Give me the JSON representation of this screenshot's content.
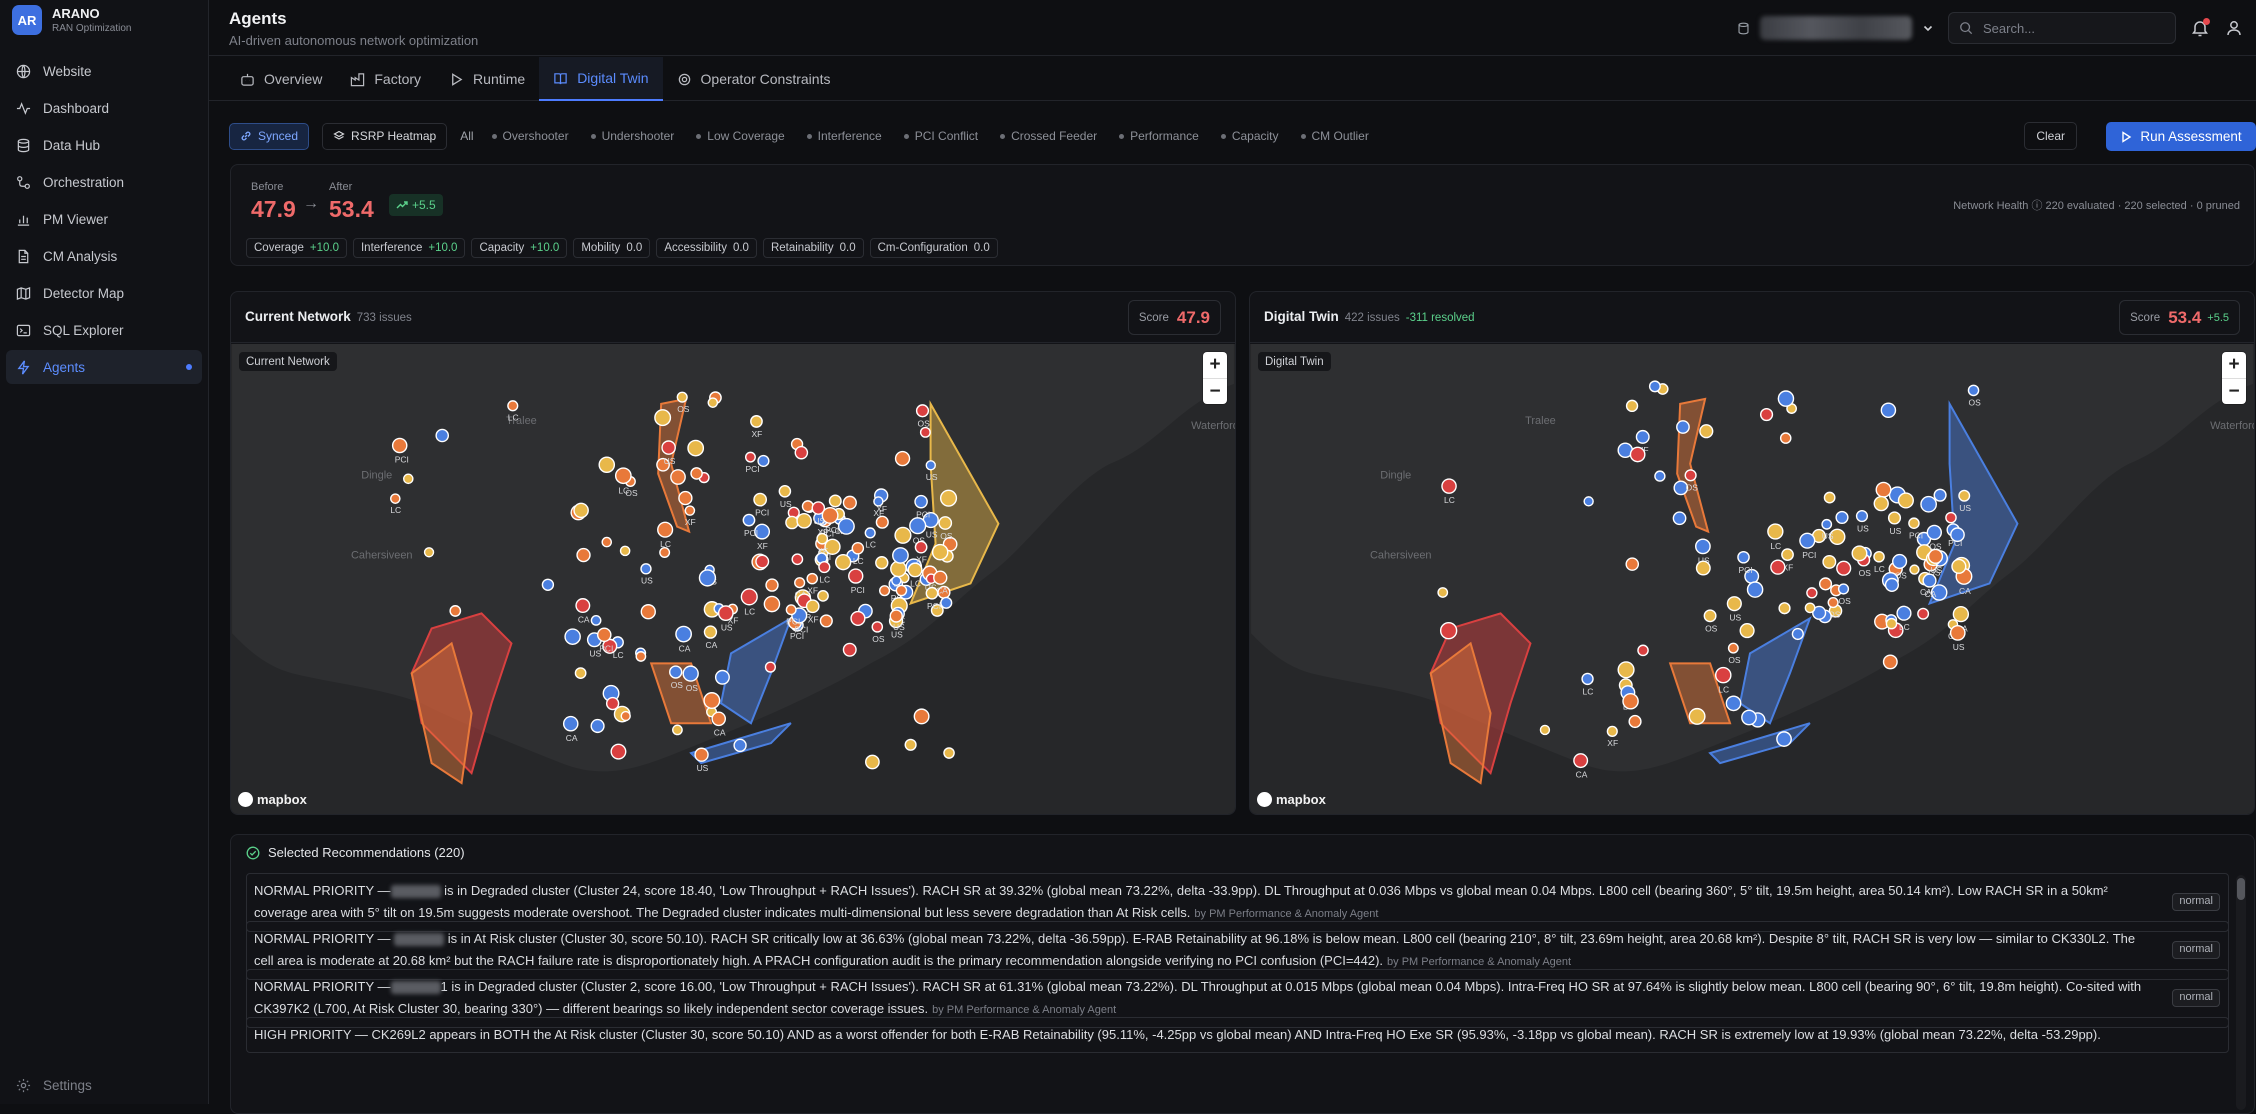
{
  "brand": {
    "logo": "AR",
    "name": "ARANO",
    "subtitle": "RAN Optimization"
  },
  "sidebar": {
    "items": [
      {
        "label": "Website",
        "icon": "globe-icon"
      },
      {
        "label": "Dashboard",
        "icon": "activity-icon"
      },
      {
        "label": "Data Hub",
        "icon": "database-icon"
      },
      {
        "label": "Orchestration",
        "icon": "workflow-icon"
      },
      {
        "label": "PM Viewer",
        "icon": "bar-chart-icon"
      },
      {
        "label": "CM Analysis",
        "icon": "file-icon"
      },
      {
        "label": "Detector Map",
        "icon": "map-icon"
      },
      {
        "label": "SQL Explorer",
        "icon": "terminal-icon"
      },
      {
        "label": "Agents",
        "icon": "zap-icon",
        "active": true
      }
    ],
    "settings": "Settings"
  },
  "header": {
    "title": "Agents",
    "subtitle": "AI-driven autonomous network optimization",
    "search_placeholder": "Search..."
  },
  "tabs": [
    "Overview",
    "Factory",
    "Runtime",
    "Digital Twin",
    "Operator Constraints"
  ],
  "active_tab": "Digital Twin",
  "filterbar": {
    "synced": "Synced",
    "heatmap": "RSRP Heatmap",
    "filters": [
      "All",
      "Overshooter",
      "Undershooter",
      "Low Coverage",
      "Interference",
      "PCI Conflict",
      "Crossed Feeder",
      "Performance",
      "Capacity",
      "CM Outlier"
    ],
    "clear": "Clear",
    "run": "Run Assessment"
  },
  "health": {
    "before_label": "Before",
    "before": "47.9",
    "after_label": "After",
    "after": "53.4",
    "delta": "+5.5",
    "metrics": [
      {
        "name": "Coverage",
        "value": "+10.0",
        "positive": true
      },
      {
        "name": "Interference",
        "value": "+10.0",
        "positive": true
      },
      {
        "name": "Capacity",
        "value": "+10.0",
        "positive": true
      },
      {
        "name": "Mobility",
        "value": "0.0",
        "positive": false
      },
      {
        "name": "Accessibility",
        "value": "0.0",
        "positive": false
      },
      {
        "name": "Retainability",
        "value": "0.0",
        "positive": false
      },
      {
        "name": "Cm-Configuration",
        "value": "0.0",
        "positive": false
      }
    ],
    "summary": "Network Health ⓘ   220 evaluated · 220 selected · 0 pruned"
  },
  "panels": {
    "current": {
      "title": "Current Network",
      "issues": "733 issues",
      "score_label": "Score",
      "score": "47.9",
      "map_label": "Current Network"
    },
    "twin": {
      "title": "Digital Twin",
      "issues": "422 issues",
      "resolved": "-311 resolved",
      "score_label": "Score",
      "score": "53.4",
      "score_delta": "+5.5",
      "map_label": "Digital Twin"
    }
  },
  "map": {
    "towns": [
      "Tralee",
      "Dingle",
      "Cahersiveen",
      "Waterford"
    ],
    "attribution": "mapbox",
    "zoom_in": "+",
    "zoom_out": "−",
    "colors": {
      "orange": "#e8793a",
      "yellow": "#e8b84a",
      "blue": "#4a7fe0",
      "red": "#d94040",
      "bg": "#262729",
      "land": "#2e2f31"
    }
  },
  "recommendations": {
    "header": "Selected Recommendations (220)",
    "items": [
      {
        "pre": "NORMAL PRIORITY —",
        "text": " is in Degraded cluster (Cluster 24, score 18.40, 'Low Throughput + RACH Issues'). RACH SR at 39.32% (global mean 73.22%, delta -33.9pp). DL Throughput at 0.036 Mbps vs global mean 0.04 Mbps. L800 cell (bearing 360°, 5° tilt, 19.5m height, area 50.14 km²). Low RACH SR in a 50km² coverage area with 5° tilt on 19.5m suggests moderate overshoot. The Degraded cluster indicates multi-dimensional but less severe degradation than At Risk cells.",
        "by": "by PM Performance & Anomaly Agent",
        "badge": "normal"
      },
      {
        "pre": "NORMAL PRIORITY — ",
        "text": " is in At Risk cluster (Cluster 30, score 50.10). RACH SR critically low at 36.63% (global mean 73.22%, delta -36.59pp). E-RAB Retainability at 96.18% is below mean. L800 cell (bearing 210°, 8° tilt, 23.69m height, area 20.68 km²). Despite 8° tilt, RACH SR is very low — similar to CK330L2. The cell area is moderate at 20.68 km² but the RACH failure rate is disproportionately high. A PRACH configuration audit is the primary recommendation alongside verifying no PCI confusion (PCI=442).",
        "by": "by PM Performance & Anomaly Agent",
        "badge": "normal"
      },
      {
        "pre": "NORMAL PRIORITY —",
        "text": "1 is in Degraded cluster (Cluster 2, score 16.00, 'Low Throughput + RACH Issues'). RACH SR at 61.31% (global mean 73.22%). DL Throughput at 0.015 Mbps (global mean 0.04 Mbps). Intra-Freq HO SR at 97.64% is slightly below mean. L800 cell (bearing 90°, 6° tilt, 19.8m height). Co-sited with CK397K2 (L700, At Risk Cluster 30, bearing 330°) — different bearings so likely independent sector coverage issues.",
        "by": "by PM Performance & Anomaly Agent",
        "badge": "normal"
      },
      {
        "pre": "HIGH PRIORITY —",
        "text": " CK269L2 appears in BOTH the At Risk cluster (Cluster 30, score 50.10) AND as a worst offender for both E-RAB Retainability (95.11%, -4.25pp vs global mean) AND Intra-Freq HO Exe SR (95.93%, -3.18pp vs global mean). RACH SR is extremely low at 19.93% (global mean 73.22%, delta -53.29pp).",
        "by": "",
        "badge": ""
      }
    ]
  }
}
